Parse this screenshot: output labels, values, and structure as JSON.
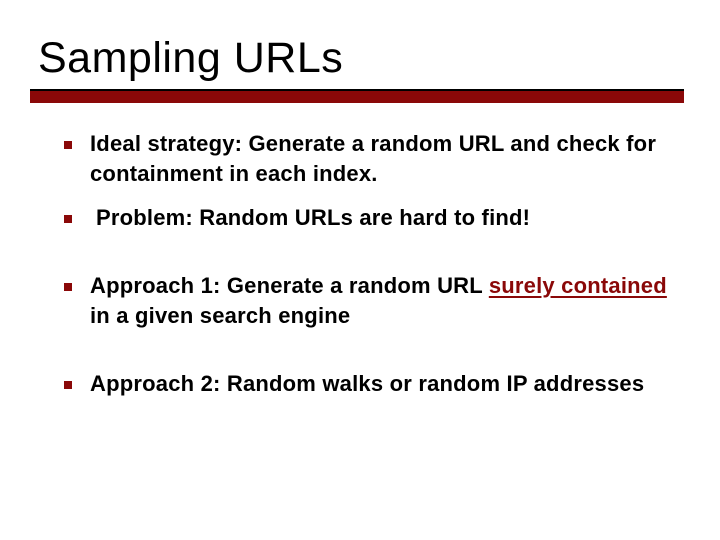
{
  "title": "Sampling URLs",
  "bullets": [
    {
      "text": "Ideal strategy: Generate a random URL and check for containment in each index."
    },
    {
      "text": "Problem: Random URLs are hard to find!",
      "indent": true
    },
    {
      "segments": [
        {
          "t": "Approach 1: Generate a random URL "
        },
        {
          "t": "surely contained",
          "u": true
        },
        {
          "t": " in a given search engine"
        }
      ]
    },
    {
      "text": "Approach 2: Random walks or random IP addresses"
    }
  ]
}
